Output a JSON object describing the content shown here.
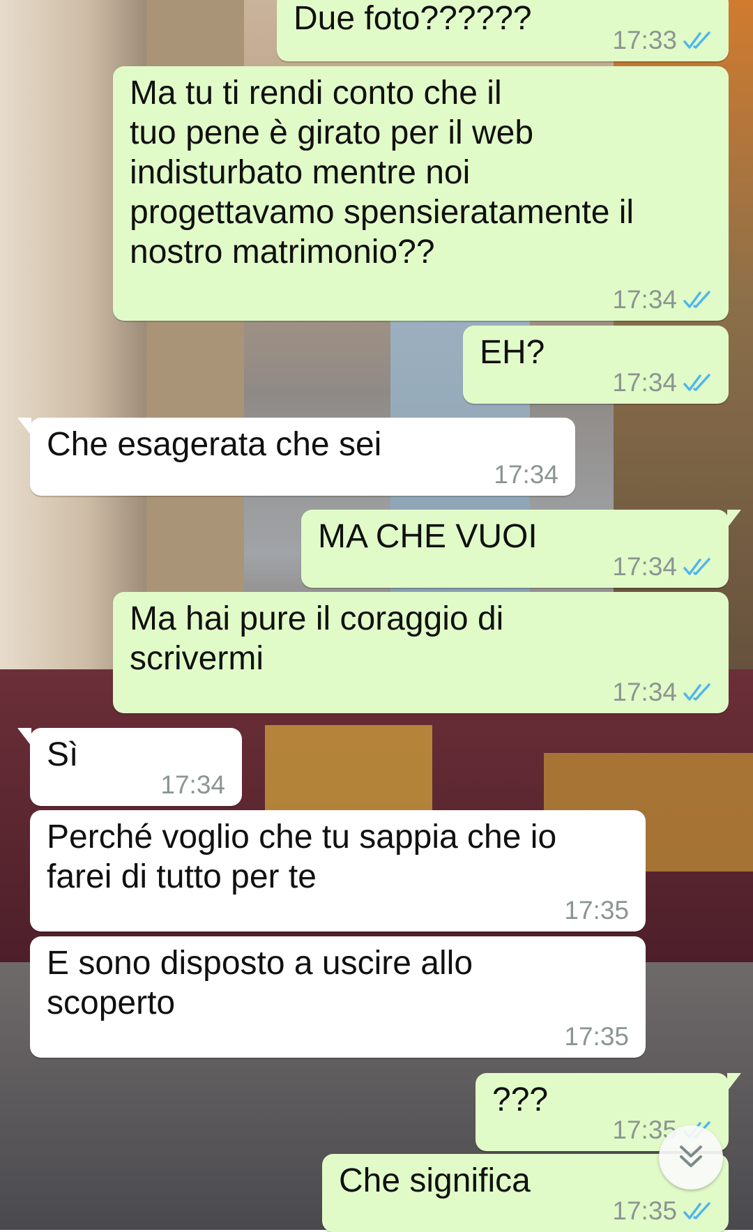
{
  "messages": [
    {
      "dir": "out",
      "text": [
        "Due foto??????"
      ],
      "time": "17:33",
      "status": "read"
    },
    {
      "dir": "out",
      "text": [
        "Ma tu ti rendi conto che il",
        "tuo pene è girato per il web",
        "indisturbato mentre noi",
        "progettavamo spensieratamente il",
        "nostro matrimonio??"
      ],
      "time": "17:34",
      "status": "read"
    },
    {
      "dir": "out",
      "text": [
        "EH?"
      ],
      "time": "17:34",
      "status": "read"
    },
    {
      "dir": "in",
      "text": [
        "Che esagerata che sei"
      ],
      "time": "17:34"
    },
    {
      "dir": "out",
      "text": [
        "MA CHE VUOI"
      ],
      "time": "17:34",
      "status": "read"
    },
    {
      "dir": "out",
      "text": [
        "Ma hai pure il coraggio di",
        "scrivermi"
      ],
      "time": "17:34",
      "status": "read"
    },
    {
      "dir": "in",
      "text": [
        "Sì"
      ],
      "time": "17:34"
    },
    {
      "dir": "in",
      "text": [
        "Perché voglio che tu sappia che io",
        "farei di tutto per te"
      ],
      "time": "17:35"
    },
    {
      "dir": "in",
      "text": [
        "E sono disposto a uscire allo",
        "scoperto"
      ],
      "time": "17:35"
    },
    {
      "dir": "out",
      "text": [
        "???"
      ],
      "time": "17:35",
      "status": "read"
    },
    {
      "dir": "out",
      "text": [
        "Che significa"
      ],
      "time": "17:35",
      "status": "read"
    }
  ],
  "colors": {
    "outgoing": "#e1fbc8",
    "incoming": "#ffffff",
    "read_tick": "#4fb6ec",
    "meta": "#8b9592"
  },
  "icons": {
    "read_receipt": "double-check-icon",
    "scroll_down": "chevron-double-down-icon"
  }
}
